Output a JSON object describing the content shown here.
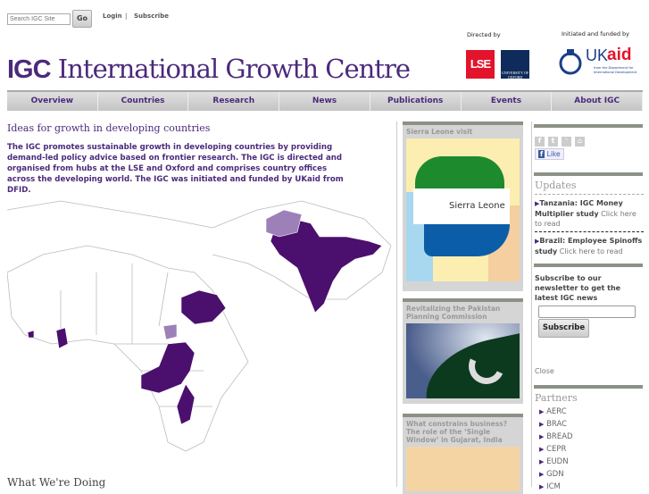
{
  "header": {
    "search_placeholder": "Search IGC Site",
    "go_label": "Go",
    "login": "Login",
    "separator": "|",
    "subscribe": "Subscribe",
    "logo_abbr": "IGC",
    "logo_name": "International Growth Centre",
    "directed_by": "Directed by",
    "lse": "LSE",
    "oxford": "UNIVERSITY OF OXFORD",
    "funded_by": "Initiated and funded by",
    "ukaid_uk": "UK",
    "ukaid_aid": "aid",
    "ukaid_sub": "from the Department for International Development"
  },
  "nav": [
    "Overview",
    "Countries",
    "Research",
    "News",
    "Publications",
    "Events",
    "About IGC"
  ],
  "main": {
    "heading": "Ideas for growth in developing countries",
    "intro": "The IGC promotes sustainable growth in developing countries by providing demand-led policy advice based on frontier research. The IGC is directed and organised from hubs at the LSE and Oxford and comprises country offices across the developing world. The IGC was initiated and funded by UKaid from DFID.",
    "section": "What We're Doing"
  },
  "features": [
    {
      "title": "Sierra Leone visit",
      "map_label": "Sierra Leone"
    },
    {
      "title": "Revitalizing the Pakistan Planning Commission"
    },
    {
      "title": "What constrains business? The role of the ‘Single Window’ in Gujarat, India"
    }
  ],
  "sidebar": {
    "like": "Like",
    "updates_title": "Updates",
    "updates": [
      {
        "title": "Tanzania: IGC Money Multiplier study",
        "link": "Click here to read"
      },
      {
        "title": "Brazil: Employee Spinoffs study",
        "link": "Click here to read"
      }
    ],
    "newsletter": "Subscribe to our newsletter to get the latest IGC news",
    "subscribe_button": "Subscribe",
    "close": "Close",
    "partners_title": "Partners",
    "partners": [
      "AERC",
      "BRAC",
      "BREAD",
      "CEPR",
      "EUDN",
      "GDN",
      "ICM"
    ]
  },
  "colors": {
    "brand": "#4b2a7b",
    "bar": "#8b9285"
  }
}
